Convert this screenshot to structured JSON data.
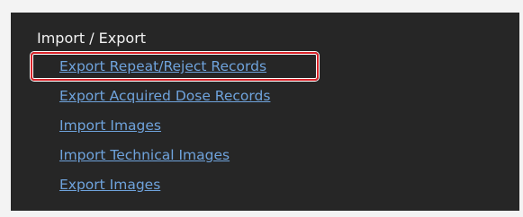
{
  "section": {
    "title": "Import / Export"
  },
  "links": [
    {
      "label": "Export Repeat/Reject Records",
      "highlighted": true
    },
    {
      "label": "Export Acquired Dose Records"
    },
    {
      "label": "Import Images"
    },
    {
      "label": "Import Technical Images"
    },
    {
      "label": "Export Images"
    }
  ],
  "colors": {
    "panel_background": "#262626",
    "title_text": "#f2f2f2",
    "link_text": "#6fa3dc",
    "highlight_border": "#d9242a"
  }
}
